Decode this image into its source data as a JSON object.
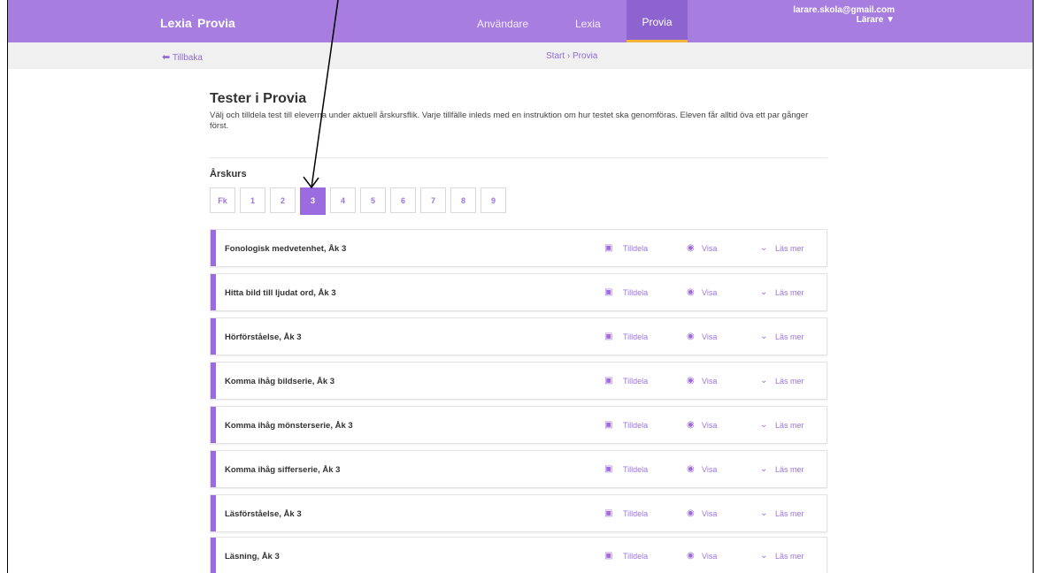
{
  "header": {
    "logo_main": "Lexia",
    "logo_mark": "·",
    "logo_sub": "Provia",
    "nav": [
      {
        "label": "Användare"
      },
      {
        "label": "Lexia"
      },
      {
        "label": "Provia",
        "active": true
      }
    ],
    "user_email": "larare.skola@gmail.com",
    "user_role": "Lärare ▼"
  },
  "subbar": {
    "back_label": "Tillbaka",
    "breadcrumb": "Start › Provia"
  },
  "main": {
    "title": "Tester i Provia",
    "intro": "Välj och tilldela test till eleverna under aktuell årskursflik. Varje tillfälle inleds med en instruktion om hur testet ska genomföras. Eleven får alltid öva ett par gånger först.",
    "grade_label": "Årskurs",
    "grades": [
      "Fk",
      "1",
      "2",
      "3",
      "4",
      "5",
      "6",
      "7",
      "8",
      "9"
    ],
    "selected_grade": "3",
    "tests": [
      "Fonologisk medvetenhet, Åk 3",
      "Hitta bild till ljudat ord, Åk 3",
      "Hörförståelse, Åk 3",
      "Komma ihåg bildserie, Åk 3",
      "Komma ihåg mönsterserie, Åk 3",
      "Komma ihåg sifferserie, Åk 3",
      "Läsförståelse, Åk 3",
      "Läsning, Åk 3"
    ],
    "actions": {
      "assign": "Tilldela",
      "view": "Visa",
      "more": "Läs mer"
    }
  },
  "colors": {
    "brand": "#a77ee0",
    "accent": "#9b6be0",
    "active_underline": "#f1b33a"
  }
}
